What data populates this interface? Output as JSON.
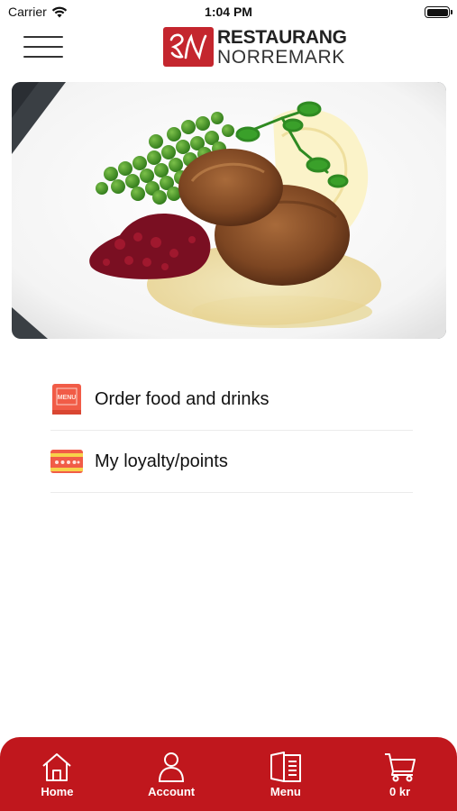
{
  "status_bar": {
    "carrier": "Carrier",
    "time": "1:04 PM"
  },
  "header": {
    "menu_icon": "hamburger-icon",
    "logo_mark": "RN",
    "logo_line1": "RESTAURANG",
    "logo_line2": "NORREMARK"
  },
  "hero": {
    "image": "meatballs-with-peas-lingonberries-and-mashed-potatoes"
  },
  "menu_items": [
    {
      "label": "Order food and drinks",
      "icon": "menu-book-icon"
    },
    {
      "label": "My loyalty/points",
      "icon": "loyalty-card-icon"
    }
  ],
  "menu_book_text": "MENU",
  "tab_bar": {
    "tabs": [
      {
        "label": "Home",
        "icon": "home-icon"
      },
      {
        "label": "Account",
        "icon": "account-icon"
      },
      {
        "label": "Menu",
        "icon": "menu-icon"
      },
      {
        "label": "0 kr",
        "icon": "cart-icon"
      }
    ]
  },
  "colors": {
    "brand_red": "#c0171d",
    "icon_coral": "#f15c47"
  }
}
